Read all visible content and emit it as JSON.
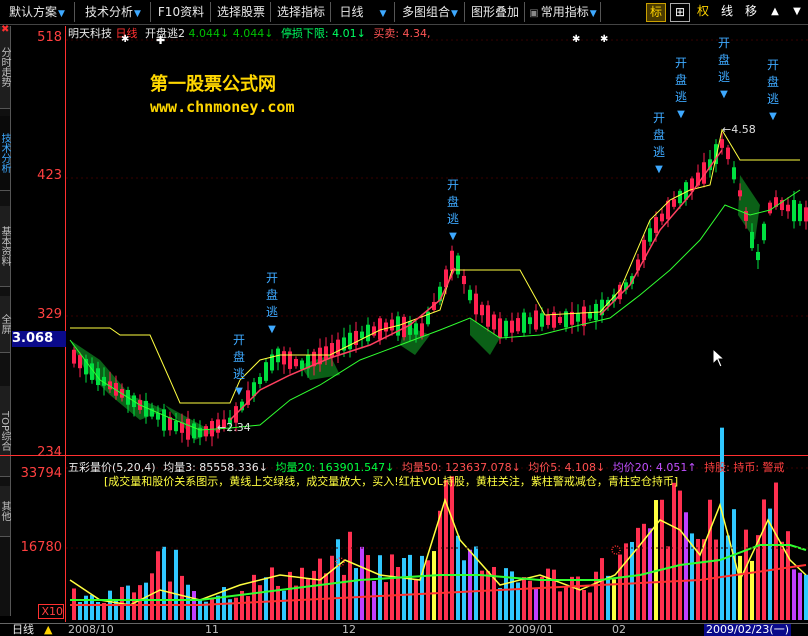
{
  "toolbar": {
    "menus": [
      {
        "label": "默认方案",
        "arrow": "▼"
      },
      {
        "label": "技术分析",
        "arrow": "▼"
      },
      {
        "label": "F10资料"
      },
      {
        "label": "选择股票"
      },
      {
        "label": "选择指标"
      },
      {
        "label": "日线",
        "arrow": "▼"
      },
      {
        "label": "多图组合",
        "arrow": "▼"
      },
      {
        "label": "图形叠加"
      },
      {
        "label": "常用指标",
        "arrow": "▼"
      }
    ],
    "icons": [
      "标",
      "⊞",
      "权",
      "线",
      "移"
    ]
  },
  "side_tabs": [
    "分时走势",
    "技术分析",
    "基本资料",
    "全屏",
    "TOP综合",
    "其他"
  ],
  "price_axis": {
    "labels": [
      "518",
      "423",
      "329",
      "234"
    ],
    "current": "3.068"
  },
  "volume_axis": {
    "labels": [
      "33794",
      "16780",
      "X10"
    ]
  },
  "main_header": {
    "stock": "明天科技",
    "period": "日线",
    "indicator": "开盘逃2",
    "v1": "4.044↓",
    "v2": "4.044↓",
    "stop": "停损下限: 4.01↓",
    "trade": "买卖: 4.34,"
  },
  "watermark": {
    "title": "第一股票公式网",
    "url": "www.chnmoney.com"
  },
  "signal_text": "开盘逃",
  "annotations": {
    "low": "2.34",
    "high": "4.58"
  },
  "vol_header": {
    "name": "五彩量价(5,20,4)",
    "l1": "均量3: 85558.336↓",
    "l2": "均量20: 163901.547↓",
    "l3": "均量50: 123637.078↓",
    "l4": "均价5: 4.108↓",
    "l5": "均价20: 4.051↑",
    "l6": "持股: 持币: 警戒",
    "desc": "[成交量和股价关系图示，黄线上交绿线，成交量放大，买入!红柱VOL持股，黄柱关注，紫柱警戒减仓，青柱空仓持币]"
  },
  "bottom": {
    "period": "日线",
    "dates": [
      "2008/10",
      "11",
      "12",
      "2009/01",
      "02"
    ],
    "date_box": "2009/02/23(一)"
  },
  "colors": {
    "up": "#ff2050",
    "down": "#00e040",
    "ma_yellow": "#ffff40",
    "ma_green": "#30ff30",
    "signal": "#1a8cff",
    "axis": "#ff3030"
  }
}
